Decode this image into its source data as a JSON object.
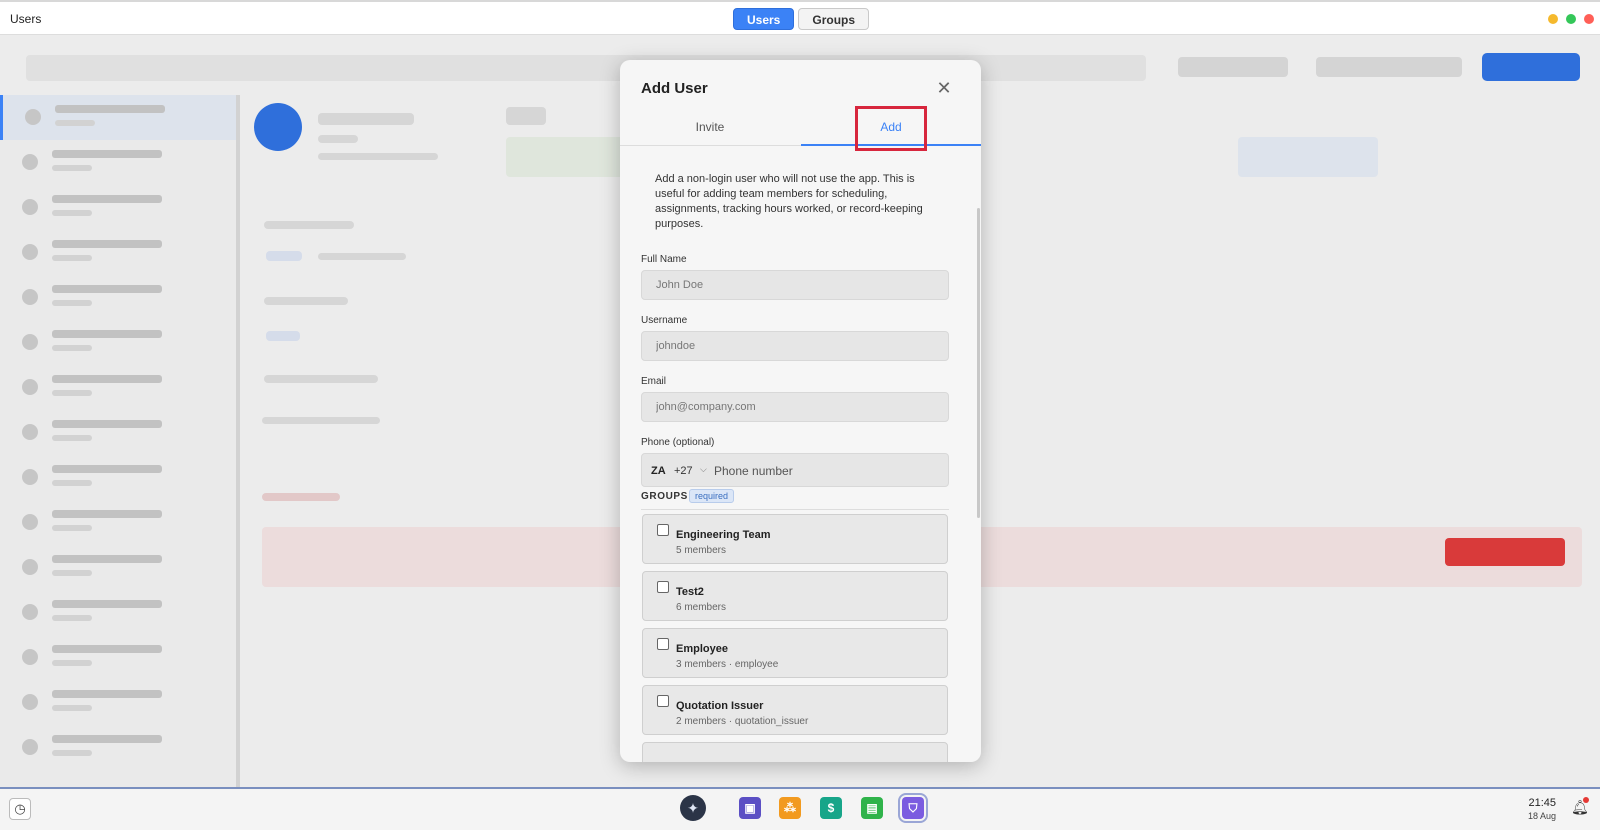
{
  "window": {
    "title": "Users"
  },
  "top_tabs": {
    "users": "Users",
    "groups": "Groups"
  },
  "colors": {
    "accent": "#3b82f6",
    "danger": "#d93a3a",
    "highlight": "#d7263d"
  },
  "modal": {
    "title": "Add User",
    "close_icon": "close-icon",
    "tabs": {
      "invite": "Invite",
      "add": "Add"
    },
    "description": "Add a non-login user who will not use the app. This is useful for adding team members for scheduling, assignments, tracking hours worked, or record-keeping purposes.",
    "fields": {
      "full_name": {
        "label": "Full Name",
        "placeholder": "John Doe"
      },
      "username": {
        "label": "Username",
        "placeholder": "johndoe"
      },
      "email": {
        "label": "Email",
        "placeholder": "john@company.com"
      },
      "phone": {
        "label": "Phone (optional)",
        "country": "ZA",
        "dial_code": "+27",
        "placeholder": "Phone number"
      }
    },
    "groups_header": "GROUPS",
    "groups_badge": "required",
    "groups": [
      {
        "name": "Engineering Team",
        "meta": "5 members"
      },
      {
        "name": "Test2",
        "meta": "6 members"
      },
      {
        "name": "Employee",
        "meta": "3 members · employee"
      },
      {
        "name": "Quotation Issuer",
        "meta": "2 members · quotation_issuer"
      }
    ]
  },
  "taskbar": {
    "time": "21:45",
    "date": "18 Aug"
  }
}
